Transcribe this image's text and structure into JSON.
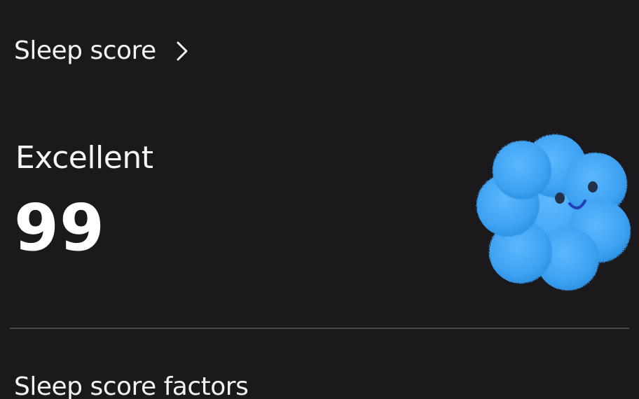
{
  "header": {
    "title": "Sleep score",
    "chevron_icon": "chevron-right-icon"
  },
  "score_card": {
    "rating_label": "Excellent",
    "score_value": "99",
    "mascot_icon": "smiling-cloud-mascot-icon",
    "mascot_color": "#42a5f5"
  },
  "factors_section": {
    "title": "Sleep score factors"
  }
}
